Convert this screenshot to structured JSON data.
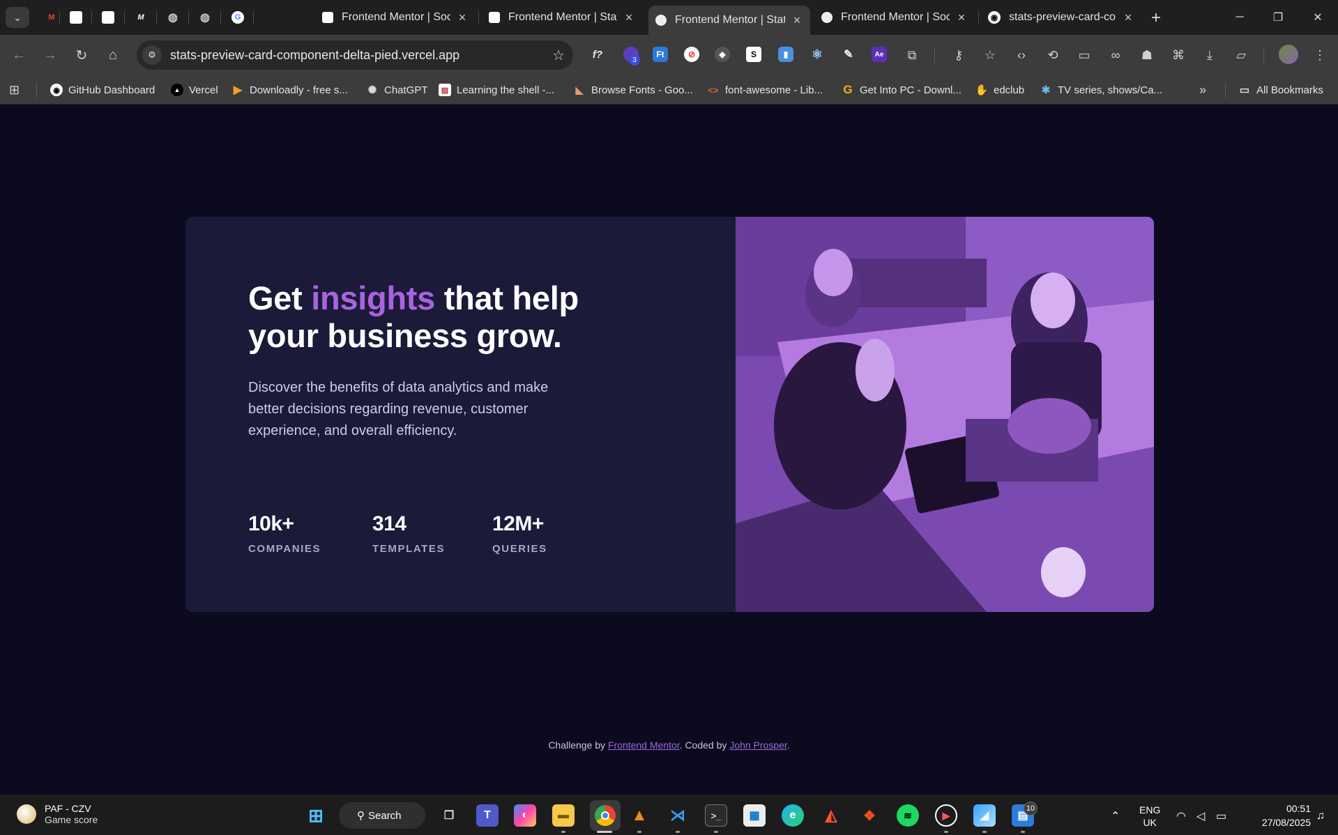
{
  "browser": {
    "tabs": [
      {
        "title": "Frontend Mentor | Soc",
        "active": false
      },
      {
        "title": "Frontend Mentor | Stat",
        "active": false
      },
      {
        "title": "Frontend Mentor | Stat",
        "active": true
      },
      {
        "title": "Frontend Mentor | Soc",
        "active": false
      },
      {
        "title": "stats-preview-card-cor",
        "active": false
      }
    ],
    "url": "stats-preview-card-component-delta-pied.vercel.app",
    "extension_badge": "3",
    "bookmarks": [
      "GitHub Dashboard",
      "Vercel",
      "Downloadly - free s...",
      "ChatGPT",
      "Learning the shell -...",
      "Browse Fonts - Goo...",
      "font-awesome - Lib...",
      "Get Into PC - Downl...",
      "edclub",
      "TV series, shows/Ca..."
    ],
    "all_bookmarks_label": "All Bookmarks"
  },
  "card": {
    "headline_pre": "Get ",
    "headline_accent": "insights",
    "headline_post": " that help your business grow.",
    "description": "Discover the benefits of data analytics and make better decisions regarding revenue, customer experience, and overall efficiency.",
    "stats": [
      {
        "value": "10k+",
        "label": "COMPANIES"
      },
      {
        "value": "314",
        "label": "TEMPLATES"
      },
      {
        "value": "12M+",
        "label": "QUERIES"
      }
    ]
  },
  "attribution": {
    "prefix": "Challenge by ",
    "link1": "Frontend Mentor",
    "middle": ". Coded by ",
    "link2": "John Prosper",
    "suffix": "."
  },
  "taskbar": {
    "weather_title": "PAF - CZV",
    "weather_sub": "Game score",
    "search_label": "Search",
    "notification_badge": "10",
    "language": "ENG",
    "region": "UK",
    "time": "00:51",
    "date": "27/08/2025"
  },
  "colors": {
    "page_bg": "#0b0a1f",
    "card_bg": "#1c1a39",
    "accent": "#a963df",
    "photo_overlay": "#aa5cdb"
  }
}
